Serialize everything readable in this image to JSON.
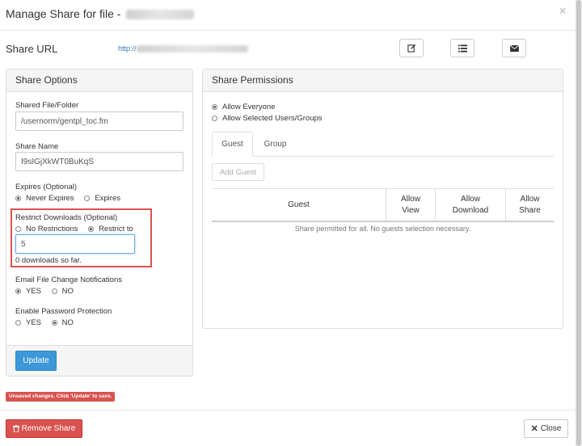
{
  "modal": {
    "title": "Manage Share for file -",
    "close_symbol": "×"
  },
  "share_url": {
    "label": "Share URL",
    "link_prefix": "http://"
  },
  "toolbar": {
    "edit_icon": "edit-icon",
    "list_icon": "list-icon",
    "email_icon": "envelope-icon"
  },
  "share_options": {
    "heading": "Share Options",
    "shared_file_label": "Shared File/Folder",
    "shared_file_value": "/usernorm/gentpl_toc.fm",
    "share_name_label": "Share Name",
    "share_name_value": "I9sIGjXkWT0BuKqS",
    "expires_label": "Expires (Optional)",
    "expires_options": [
      "Never Expires",
      "Expires"
    ],
    "restrict_label": "Restrict Downloads (Optional)",
    "restrict_options": [
      "No Restrictions",
      "Restrict to"
    ],
    "restrict_value": "5",
    "downloads_so_far": "0 downloads so far.",
    "email_label": "Email File Change Notifications",
    "email_options": [
      "YES",
      "NO"
    ],
    "password_label": "Enable Password Protection",
    "password_options": [
      "YES",
      "NO"
    ],
    "update_label": "Update"
  },
  "share_permissions": {
    "heading": "Share Permissions",
    "allow_options": [
      "Allow Everyone",
      "Allow Selected Users/Groups"
    ],
    "tabs": [
      "Guest",
      "Group"
    ],
    "add_guest_label": "Add Guest",
    "columns": [
      "Guest",
      "Allow View",
      "Allow Download",
      "Allow Share"
    ],
    "note": "Share permitted for all. No guests selection necessary."
  },
  "footer": {
    "unsaved_warning": "Unsaved changes. Click 'Update' to save.",
    "remove_label": "Remove Share",
    "close_label": "Close"
  },
  "colors": {
    "primary": "#3c98d8",
    "danger": "#d9534f",
    "link": "#337ab7"
  }
}
